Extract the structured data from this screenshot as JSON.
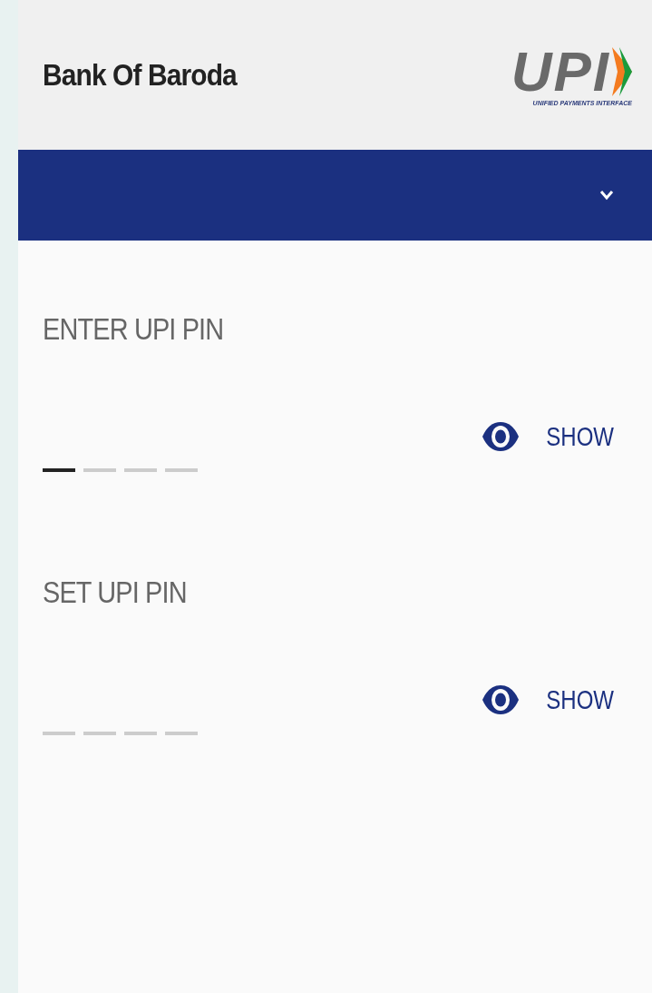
{
  "header": {
    "bank_name": "Bank Of Baroda",
    "logo": {
      "mark": "UPI",
      "tagline": "UNIFIED PAYMENTS INTERFACE"
    }
  },
  "account_bar": {
    "expanded": false
  },
  "pin_fields": [
    {
      "label": "ENTER UPI PIN",
      "show_label": "SHOW",
      "slots": [
        {
          "active": true
        },
        {
          "active": false
        },
        {
          "active": false
        },
        {
          "active": false
        }
      ]
    },
    {
      "label": "SET UPI PIN",
      "show_label": "SHOW",
      "slots": [
        {
          "active": false
        },
        {
          "active": false
        },
        {
          "active": false
        },
        {
          "active": false
        }
      ]
    }
  ]
}
